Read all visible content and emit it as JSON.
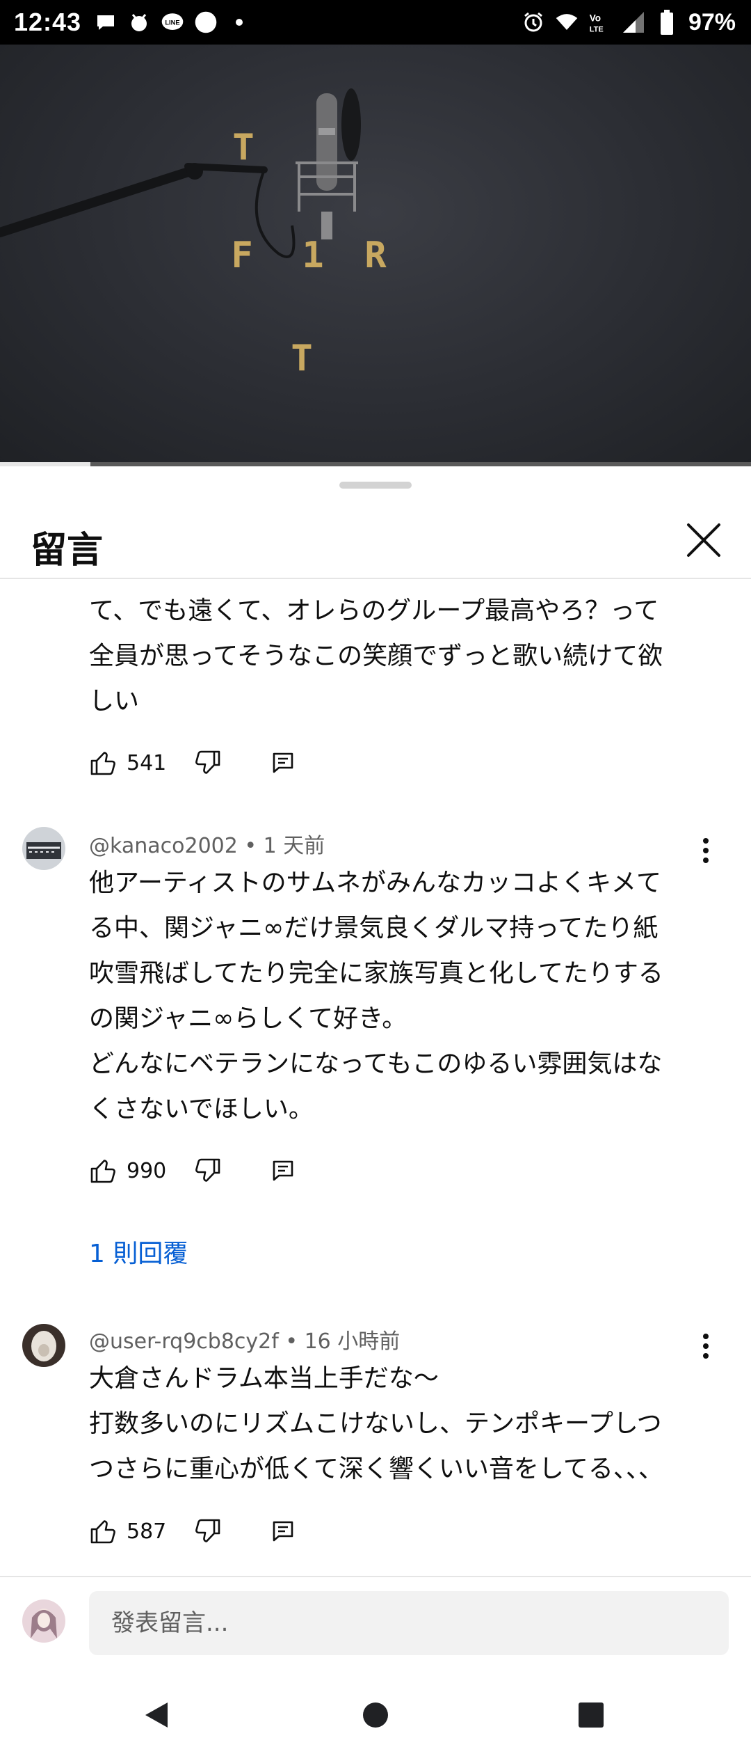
{
  "status_bar": {
    "time": "12:43",
    "battery": "97%",
    "icons_left": [
      "chat-bubble-icon",
      "notification-app-icon",
      "line-app-icon",
      "circle-icon",
      "dot-icon"
    ],
    "icons_right": [
      "alarm-icon",
      "wifi-icon",
      "volte-icon",
      "signal-icon",
      "battery-icon"
    ]
  },
  "video": {
    "letters": [
      "T",
      "F",
      "1",
      "R",
      "T"
    ],
    "progress_percent": 12
  },
  "sheet": {
    "title": "留言"
  },
  "comments": [
    {
      "text_lines": [
        "て、でも遠くて、オレらのグループ最高やろ？って",
        "全員が思ってそうなこの笑顔でずっと歌い続けて欲",
        "しい"
      ],
      "likes": "541"
    },
    {
      "author": "@kanaco2002",
      "time": "1 天前",
      "text_lines": [
        "他アーティストのサムネがみんなカッコよくキメて",
        "る中、関ジャニ∞だけ景気良くダルマ持ってたり紙",
        "吹雪飛ばしてたり完全に家族写真と化してたりする",
        "の関ジャニ∞らしくて好き。",
        "どんなにベテランになってもこのゆるい雰囲気はな",
        "くさないでほしい。"
      ],
      "likes": "990",
      "replies_label": "1 則回覆"
    },
    {
      "author": "@user-rq9cb8cy2f",
      "time": "16 小時前",
      "text_lines": [
        "大倉さんドラム本当上手だな～",
        "打数多いのにリズムこけないし、テンポキープしつ",
        "つさらに重心が低くて深く響くいい音をしてる、、、"
      ],
      "likes": "587"
    }
  ],
  "composer": {
    "placeholder": "發表留言..."
  },
  "nav": {
    "buttons": [
      "back-icon",
      "home-icon",
      "recents-icon"
    ]
  },
  "colors": {
    "link": "#065fd4",
    "video_bg": "#2b2d33",
    "gold": "#c8a860"
  }
}
